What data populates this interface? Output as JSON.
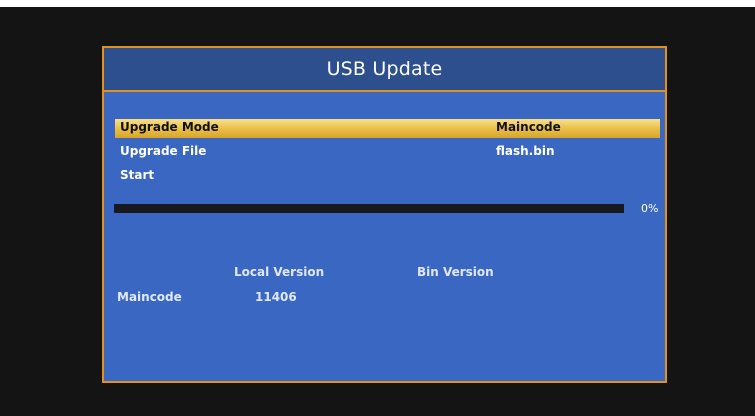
{
  "dialog": {
    "title": "USB Update"
  },
  "menu": {
    "items": [
      {
        "label": "Upgrade Mode",
        "value": "Maincode",
        "selected": true
      },
      {
        "label": "Upgrade File",
        "value": "flash.bin",
        "selected": false
      },
      {
        "label": "Start",
        "value": "",
        "selected": false
      }
    ]
  },
  "progress": {
    "value": 0,
    "label": "0%"
  },
  "versions": {
    "local_header": "Local Version",
    "bin_header": "Bin Version",
    "rows": [
      {
        "name": "Maincode",
        "local": "11406",
        "bin": ""
      }
    ]
  },
  "colors": {
    "panel_bg": "#3a67c2",
    "header_bg": "#2d4f8e",
    "border": "#e3901f",
    "highlight": "#e8bd44",
    "screen_bg": "#141414",
    "progress_track": "#17191f"
  }
}
